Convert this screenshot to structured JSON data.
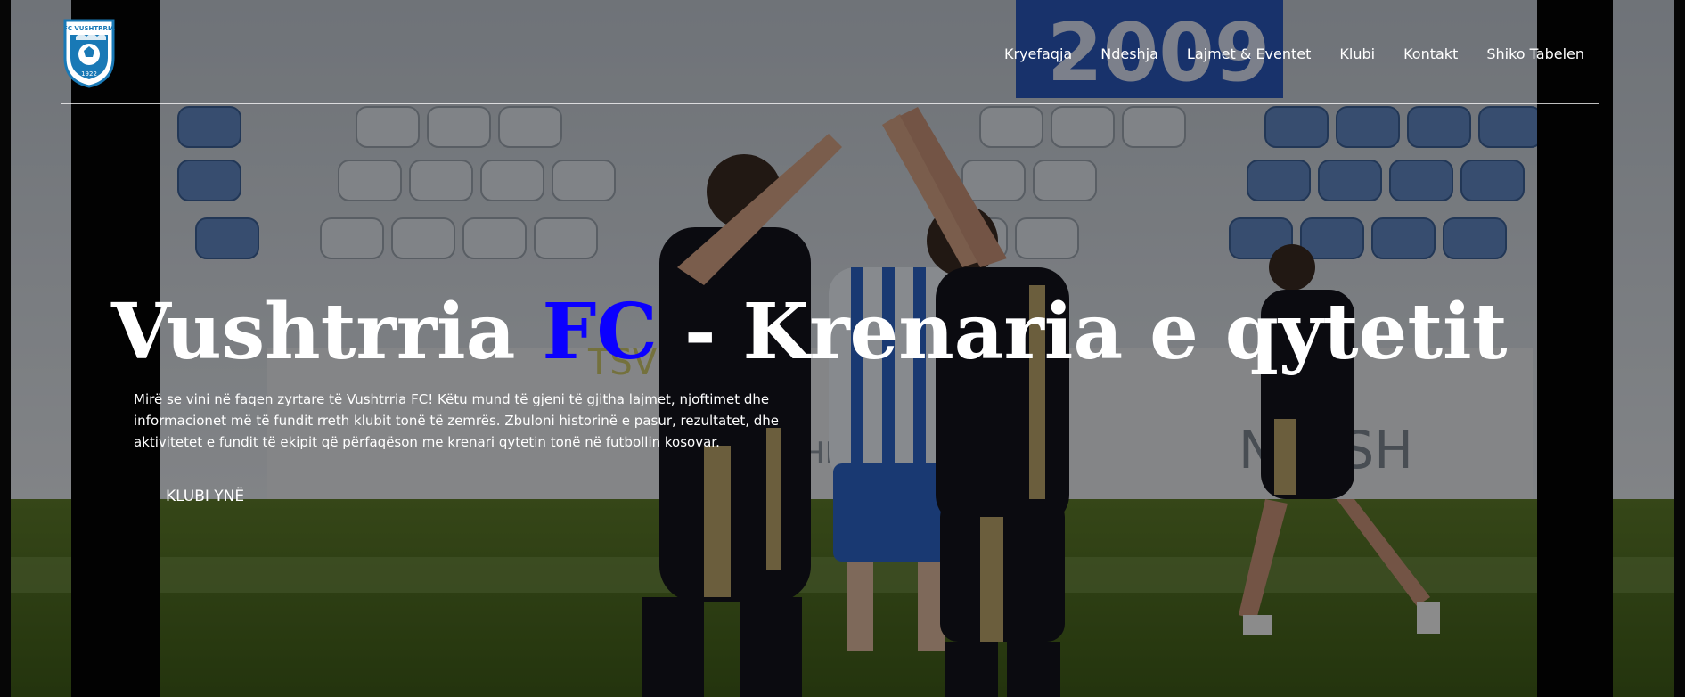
{
  "header": {
    "logo_text": "FC VUSHTRRIA",
    "logo_year": "1922",
    "nav": [
      {
        "label": "Kryefaqja"
      },
      {
        "label": "Ndeshja"
      },
      {
        "label": "Lajmet & Eventet"
      },
      {
        "label": "Klubi"
      },
      {
        "label": "Kontakt"
      },
      {
        "label": "Shiko Tabelen"
      }
    ]
  },
  "hero": {
    "title_part1": "Vushtrria ",
    "title_accent": "FC",
    "title_part2": " - Krenaria e qytetit",
    "intro": "Mirë se vini në faqen zyrtare të Vushtrria FC! Këtu mund të gjeni të gjitha lajmet, njoftimet dhe informacionet më të fundit rreth klubit tonë të zemrës. Zbuloni historinë e pasur, rezultatet, dhe aktivitetet e fundit të ekipit që përfaqëson me krenari qytetin tonë në futbollin kosovar.",
    "cta_label": "KLUBI YNË",
    "background_text": [
      "2009",
      "N",
      "TSH",
      "HL",
      "TSV"
    ]
  },
  "colors": {
    "accent": "#0b00ff",
    "text": "#ffffff",
    "logo_blue": "#1979b6",
    "pitch_green": "#3e5a18",
    "kit_black": "#14141c",
    "kit_gold": "#b9a36a"
  }
}
